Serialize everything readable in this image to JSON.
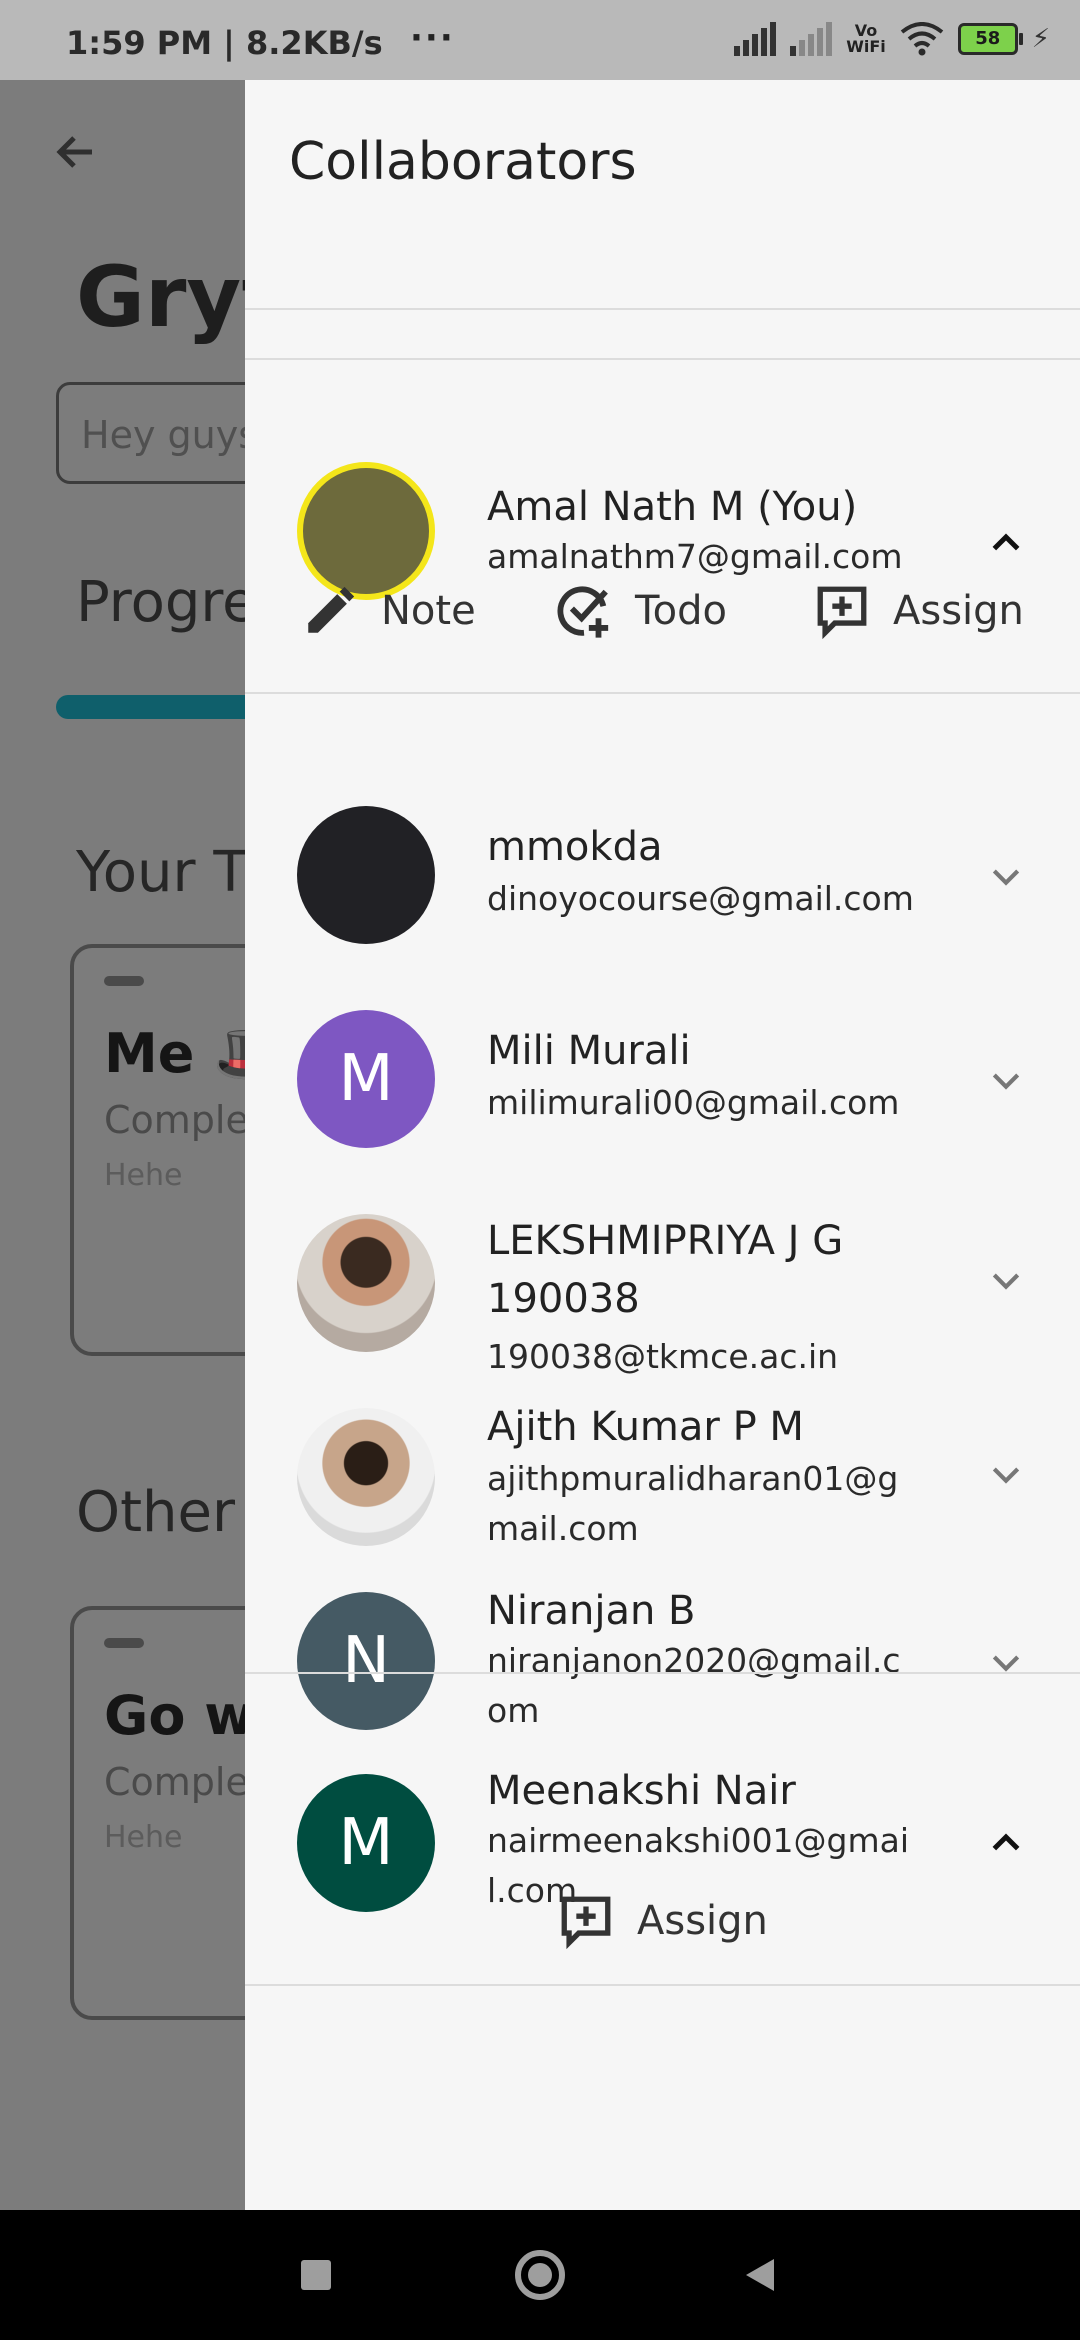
{
  "status_bar": {
    "time": "1:59 PM | 8.2KB/s",
    "more": "···",
    "volte_line1": "Vo",
    "volte_line2": "WiFi",
    "battery": "58"
  },
  "background": {
    "title": "Gryf",
    "input_text": "Hey guys",
    "progress_label": "Progre",
    "your_section": "Your T",
    "other_section": "Other",
    "cards": [
      {
        "title": "Me 🎩",
        "subtitle": "Comple",
        "note": "Hehe"
      },
      {
        "title": "Go w",
        "subtitle": "Comple",
        "note": "Hehe"
      }
    ]
  },
  "drawer": {
    "title": "Collaborators",
    "collaborators": [
      {
        "name": "Amal Nath M (You)",
        "email": "amalnathm7@gmail.com",
        "expanded": true,
        "avatar": "photo"
      },
      {
        "name": "mmokda",
        "email": "dinoyocourse@gmail.com",
        "expanded": false,
        "avatar": "dark-circle"
      },
      {
        "name": "Mili Murali",
        "email": "milimurali00@gmail.com",
        "expanded": false,
        "initial": "M",
        "color": "#7e57c2"
      },
      {
        "name": "LEKSHMIPRIYA J G 190038",
        "email": "190038@tkmce.ac.in",
        "expanded": false,
        "avatar": "photo"
      },
      {
        "name": "Ajith Kumar P M",
        "email": "ajithpmuralidharan01@gmail.com",
        "expanded": false,
        "avatar": "photo"
      },
      {
        "name": "Niranjan B",
        "email": "niranjanon2020@gmail.com",
        "expanded": false,
        "initial": "N",
        "color": "#455a64"
      },
      {
        "name": "Meenakshi Nair",
        "email": "nairmeenakshi001@gmail.com",
        "expanded": true,
        "initial": "M",
        "color": "#004d40"
      }
    ],
    "self_actions": {
      "note": "Note",
      "todo": "Todo",
      "assign": "Assign"
    },
    "other_actions": {
      "assign": "Assign"
    }
  },
  "nav": {
    "icons": [
      "recent-apps-icon",
      "home-icon",
      "back-icon"
    ]
  }
}
